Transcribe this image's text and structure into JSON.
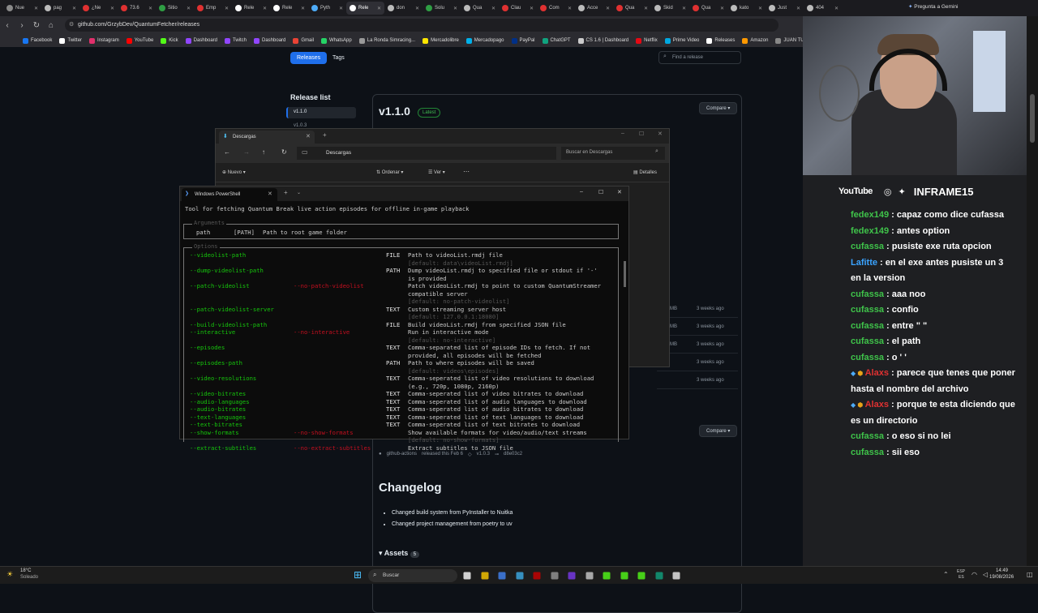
{
  "browser": {
    "tabs": [
      "Nue",
      "pag",
      "¿Ne",
      "73.6",
      "Sitio",
      "Emp",
      "Rele",
      "Rele",
      "Pyth",
      "Rele",
      "don",
      "Solu",
      "Qua",
      "Clau",
      "Com",
      "Acce",
      "Qua",
      "Skid",
      "Qua",
      "kato",
      "Just",
      "404"
    ],
    "tab_fav_colors": [
      "#8a8a8a",
      "#bbbbbb",
      "#e03131",
      "#e03131",
      "#2f9e44",
      "#e03131",
      "#ffffff",
      "#ffffff",
      "#4dabf7",
      "#ffffff",
      "#bbbbbb",
      "#2f9e44",
      "#bbbbbb",
      "#e03131",
      "#e03131",
      "#bbbbbb",
      "#e03131",
      "#bbbbbb",
      "#e03131",
      "#bbbbbb",
      "#bbbbbb",
      "#bbbbbb"
    ],
    "active_tab": 9,
    "gemini": "Pregunta a Gemini",
    "url": "github.com/GrzybDev/QuantumFetcher/releases",
    "bookmarks": [
      "Facebook",
      "Twitter",
      "Instagram",
      "YouTube",
      "Kick",
      "Dashboard",
      "Twitch",
      "Dashboard",
      "Gmail",
      "WhatsApp",
      "La Ronda Simracing...",
      "Mercadolibre",
      "Mercadopago",
      "PayPal",
      "ChatGPT",
      "CS 1.6 | Dashboard",
      "Netflix",
      "Prime Video",
      "Releases",
      "Amazon",
      "JUAN TURR"
    ],
    "bookmark_colors": [
      "#1877f2",
      "#ffffff",
      "#e1306c",
      "#ff0000",
      "#53fc18",
      "#9146ff",
      "#9146ff",
      "#9146ff",
      "#ea4335",
      "#25d366",
      "#999999",
      "#ffe600",
      "#00b1ea",
      "#003087",
      "#10a37f",
      "#cccccc",
      "#e50914",
      "#00a8e1",
      "#ffffff",
      "#ff9900",
      "#888888"
    ]
  },
  "github": {
    "releases_tab": "Releases",
    "tags_tab": "Tags",
    "find_placeholder": "Find a release",
    "release_list_title": "Release list",
    "release_list": [
      "v1.1.0",
      "v1.0.3"
    ],
    "version": "v1.1.0",
    "latest": "Latest",
    "compare": "Compare",
    "asset_rows": [
      {
        "size": "MB",
        "when": "3 weeks ago"
      },
      {
        "size": "MB",
        "when": "3 weeks ago"
      },
      {
        "size": "MB",
        "when": "3 weeks ago"
      },
      {
        "size": "",
        "when": "3 weeks ago"
      },
      {
        "size": "",
        "when": "3 weeks ago"
      }
    ],
    "compare2": "Compare",
    "author": "github-actions",
    "released_text": "released this Feb 6",
    "tag": "v1.0.3",
    "commit": "d8e03c2",
    "changelog_title": "Changelog",
    "changelog": [
      "Changed build system from PyInstaller to Nuitka",
      "Changed project management from poetry to uv"
    ],
    "assets_title": "Assets",
    "assets_count": "5"
  },
  "explorer": {
    "title": "Descargas",
    "path": "Descargas",
    "search_placeholder": "Buscar en Descargas",
    "new_label": "Nuevo",
    "sort_label": "Ordenar",
    "view_label": "Ver",
    "details_label": "Detalles"
  },
  "powershell": {
    "title": "Windows PowerShell",
    "description": "Tool for fetching Quantum Break live action episodes for offline in-game playback",
    "arguments_title": "Arguments",
    "argument": {
      "name": "path",
      "type": "[PATH]",
      "desc": "Path to root game folder"
    },
    "options_title": "Options",
    "options": [
      {
        "name": "--videolist-path",
        "neg": "",
        "type": "FILE",
        "desc": "Path to videoList.rmdj file",
        "def": "[default: data\\videoList.rmdj]"
      },
      {
        "name": "--dump-videolist-path",
        "neg": "",
        "type": "PATH",
        "desc": "Dump videoList.rmdj to specified file or stdout if '-'",
        "desc2": "is provided",
        "def": ""
      },
      {
        "name": "--patch-videolist",
        "neg": "--no-patch-videolist",
        "type": "",
        "desc": "Patch videoList.rmdj to point to custom QuantumStreamer",
        "desc2": "compatible server",
        "def": "[default: no-patch-videolist]"
      },
      {
        "name": "--patch-videolist-server",
        "neg": "",
        "type": "TEXT",
        "desc": "Custom streaming server host",
        "def": "[default: 127.0.0.1:18080]"
      },
      {
        "name": "--build-videolist-path",
        "neg": "",
        "type": "FILE",
        "desc": "Build videoList.rmdj from specified JSON file",
        "def": ""
      },
      {
        "name": "--interactive",
        "neg": "--no-interactive",
        "type": "",
        "desc": "Run in interactive mode",
        "def": "[default: no-interactive]"
      },
      {
        "name": "--episodes",
        "neg": "",
        "type": "TEXT",
        "desc": "Comma-separated list of episode IDs to fetch. If not",
        "desc2": "provided, all episodes will be fetched",
        "def": ""
      },
      {
        "name": "--episodes-path",
        "neg": "",
        "type": "PATH",
        "desc": "Path to where episodes will be saved",
        "def": "[default: videos\\episodes]"
      },
      {
        "name": "--video-resolutions",
        "neg": "",
        "type": "TEXT",
        "desc": "Comma-seperated list of video resolutions to download",
        "desc2": "(e.g., 720p, 1080p, 2160p)",
        "def": ""
      },
      {
        "name": "--video-bitrates",
        "neg": "",
        "type": "TEXT",
        "desc": "Comma-seperated list of video bitrates to download",
        "def": ""
      },
      {
        "name": "--audio-languages",
        "neg": "",
        "type": "TEXT",
        "desc": "Comma-seperated list of audio languages to download",
        "def": ""
      },
      {
        "name": "--audio-bitrates",
        "neg": "",
        "type": "TEXT",
        "desc": "Comma-seperated list of audio bitrates to download",
        "def": ""
      },
      {
        "name": "--text-languages",
        "neg": "",
        "type": "TEXT",
        "desc": "Comma-seperated list of text languages to download",
        "def": ""
      },
      {
        "name": "--text-bitrates",
        "neg": "",
        "type": "TEXT",
        "desc": "Comma-seperated list of text bitrates to download",
        "def": ""
      },
      {
        "name": "--show-formats",
        "neg": "--no-show-formats",
        "type": "",
        "desc": "Show available formats for video/audio/text streams",
        "def": "[default: no-show-formats]"
      },
      {
        "name": "--extract-subtitles",
        "neg": "--no-extract-subtitles",
        "type": "",
        "desc": "Extract subtitles to JSON file",
        "def": ""
      }
    ]
  },
  "stream": {
    "youtube": "YouTube",
    "handle": "INFRAME15"
  },
  "chat": [
    {
      "user": "fedex149",
      "text": "capaz como dice cufassa",
      "color": "#3fc34a",
      "badges": false
    },
    {
      "user": "fedex149",
      "text": "antes option",
      "color": "#3fc34a",
      "badges": false
    },
    {
      "user": "cufassa",
      "text": "pusiste exe ruta opcion",
      "color": "#3fc34a",
      "badges": false
    },
    {
      "user": "Lafitte",
      "text": "en el exe antes pusiste un 3 en la version",
      "color": "#3aa3ff",
      "badges": false
    },
    {
      "user": "cufassa",
      "text": "aaa noo",
      "color": "#3fc34a",
      "badges": false
    },
    {
      "user": "cufassa",
      "text": "confio",
      "color": "#3fc34a",
      "badges": false
    },
    {
      "user": "cufassa",
      "text": "entre \" \"",
      "color": "#3fc34a",
      "badges": false
    },
    {
      "user": "cufassa",
      "text": "el path",
      "color": "#3fc34a",
      "badges": false
    },
    {
      "user": "cufassa",
      "text": "o ' '",
      "color": "#3fc34a",
      "badges": false
    },
    {
      "user": "Alaxs",
      "text": "parece que tenes que poner hasta el nombre del archivo",
      "color": "#e03131",
      "badges": true
    },
    {
      "user": "Alaxs",
      "text": "porque te esta diciendo que es un directorio",
      "color": "#e03131",
      "badges": true
    },
    {
      "user": "cufassa",
      "text": "o eso si no lei",
      "color": "#3fc34a",
      "badges": false
    },
    {
      "user": "cufassa",
      "text": "sii eso",
      "color": "#3fc34a",
      "badges": false
    }
  ],
  "taskbar": {
    "temp": "18°C",
    "weather": "Soleado",
    "search": "Buscar",
    "lang1": "ESP",
    "lang2": "ES",
    "time": "14:49",
    "date": "19/08/2026"
  }
}
